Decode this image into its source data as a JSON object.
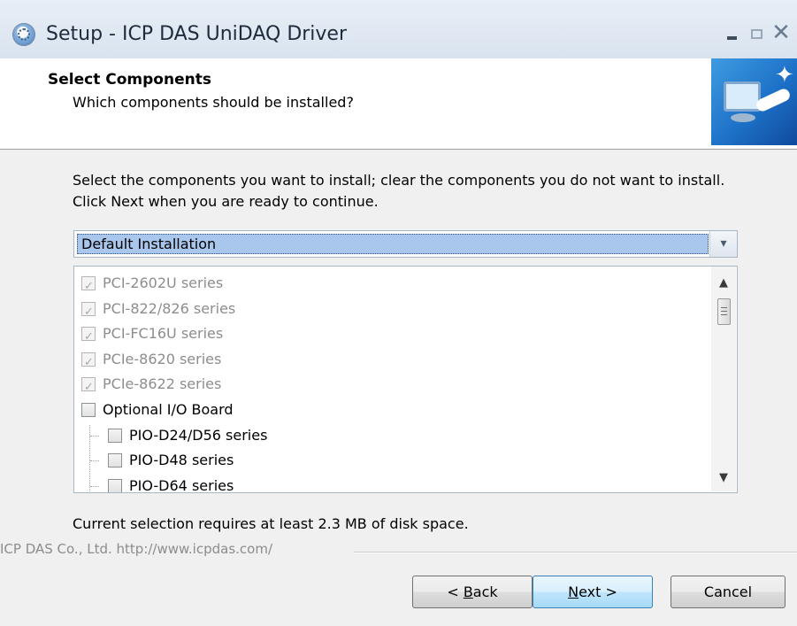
{
  "window": {
    "title": "Setup - ICP DAS UniDAQ Driver",
    "close_glyph": "✕"
  },
  "header": {
    "title": "Select Components",
    "subtitle": "Which components should be installed?"
  },
  "description": "Select the components you want to install; clear the components you do not want to install. Click Next when you are ready to continue.",
  "install_type": {
    "selected": "Default Installation",
    "arrow_glyph": "▾"
  },
  "components": [
    {
      "label": "PCI-2602U series",
      "checked": true,
      "disabled": true,
      "level": 0
    },
    {
      "label": "PCI-822/826 series",
      "checked": true,
      "disabled": true,
      "level": 0
    },
    {
      "label": "PCI-FC16U series",
      "checked": true,
      "disabled": true,
      "level": 0
    },
    {
      "label": "PCIe-8620 series",
      "checked": true,
      "disabled": true,
      "level": 0
    },
    {
      "label": "PCIe-8622 series",
      "checked": true,
      "disabled": true,
      "level": 0
    },
    {
      "label": "Optional I/O Board",
      "checked": false,
      "disabled": false,
      "level": 0
    },
    {
      "label": "PIO-D24/D56 series",
      "checked": false,
      "disabled": false,
      "level": 1
    },
    {
      "label": "PIO-D48 series",
      "checked": false,
      "disabled": false,
      "level": 1
    },
    {
      "label": "PIO-D64 series",
      "checked": false,
      "disabled": false,
      "level": 1
    }
  ],
  "scrollbar": {
    "up_glyph": "▲",
    "down_glyph": "▼"
  },
  "disk_space": "Current selection requires at least 2.3 MB of disk space.",
  "footer_brand": "ICP DAS Co., Ltd. http://www.icpdas.com/",
  "buttons": {
    "back": {
      "prefix": "< ",
      "hotkey": "B",
      "rest": "ack"
    },
    "next": {
      "hotkey": "N",
      "rest": "ext >"
    },
    "cancel": "Cancel"
  },
  "icons": {
    "app": "setup-disc-icon",
    "header": "computer-install-icon",
    "check": "✓"
  },
  "colors": {
    "selection_highlight": "#a9c6ec",
    "header_image_blue": "#1d71c8",
    "disabled_text": "#8d8d8d",
    "default_button_border": "#3c7fb1"
  }
}
